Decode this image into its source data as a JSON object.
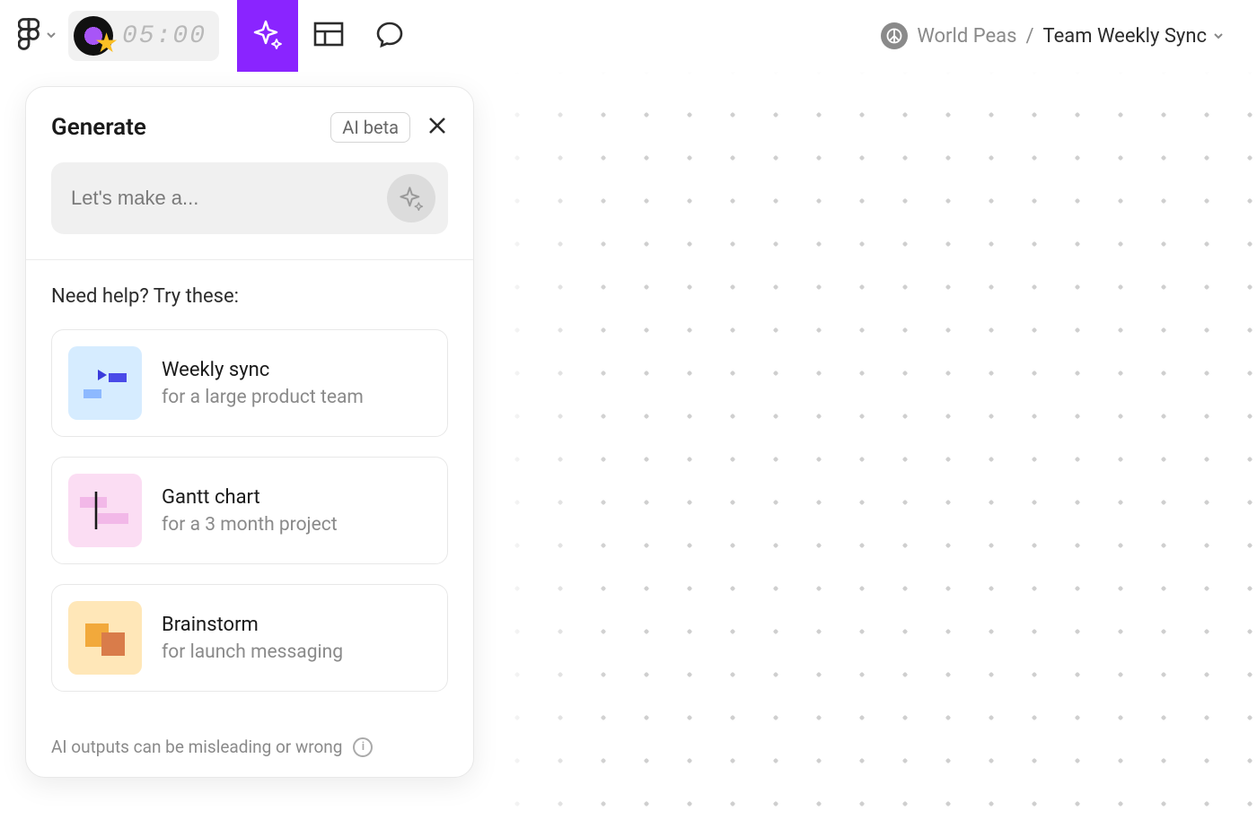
{
  "toolbar": {
    "timer": "05:00"
  },
  "breadcrumb": {
    "project": "World Peas",
    "separator": "/",
    "file": "Team Weekly Sync"
  },
  "panel": {
    "title": "Generate",
    "ai_badge": "AI beta",
    "prompt_placeholder": "Let's make a...",
    "suggest_heading": "Need help? Try these:",
    "suggestions": [
      {
        "title": "Weekly sync",
        "subtitle": "for a large product team"
      },
      {
        "title": "Gantt chart",
        "subtitle": "for a 3 month project"
      },
      {
        "title": "Brainstorm",
        "subtitle": "for launch messaging"
      }
    ],
    "disclaimer": "AI outputs can be misleading or wrong"
  },
  "icons": {
    "figma": "figma-logo-icon",
    "chevron_down": "chevron-down-icon",
    "vinyl": "vinyl-icon",
    "star": "star-icon",
    "sparkle": "sparkle-icon",
    "table": "table-icon",
    "chat": "chat-bubble-icon",
    "peace": "peace-icon",
    "close": "close-icon",
    "info": "info-icon"
  }
}
